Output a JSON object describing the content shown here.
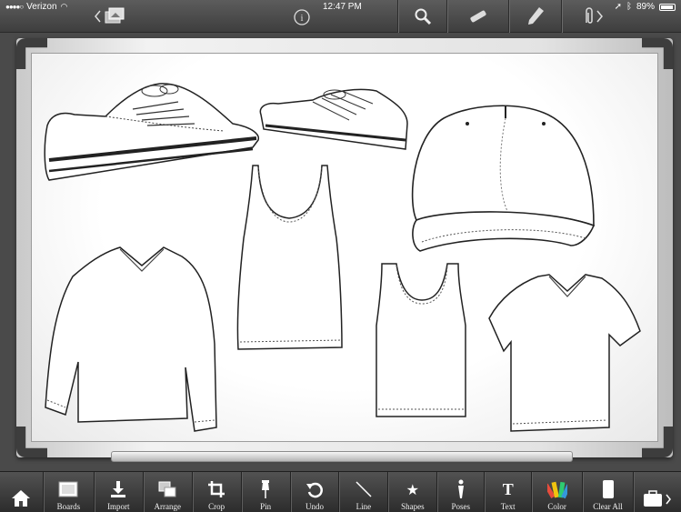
{
  "status_bar": {
    "carrier": "Verizon",
    "time": "12:47 PM",
    "battery": "89%"
  },
  "top_toolbar": {
    "left_icon": "photos-back-icon",
    "info_icon": "info-icon",
    "search_icon": "search-icon",
    "marker_icon": "marker-icon",
    "pencil_icon": "pencil-icon",
    "attach_icon": "paperclip-forward-icon"
  },
  "board": {
    "items": [
      "sneaker-left",
      "sneaker-right",
      "baseball-cap",
      "tank-top-women",
      "long-sleeve-vneck",
      "tank-top-men",
      "tshirt-vneck"
    ]
  },
  "bottom_toolbar": {
    "items": [
      {
        "label": "",
        "icon": "home-icon"
      },
      {
        "label": "Boards",
        "icon": "boards-icon"
      },
      {
        "label": "Import",
        "icon": "import-icon"
      },
      {
        "label": "Arrange",
        "icon": "arrange-icon"
      },
      {
        "label": "Crop",
        "icon": "crop-icon"
      },
      {
        "label": "Pin",
        "icon": "pin-icon"
      },
      {
        "label": "Undo",
        "icon": "undo-icon"
      },
      {
        "label": "Line",
        "icon": "line-icon"
      },
      {
        "label": "Shapes",
        "icon": "star-icon"
      },
      {
        "label": "Poses",
        "icon": "pose-icon"
      },
      {
        "label": "Text",
        "icon": "text-icon"
      },
      {
        "label": "Color",
        "icon": "color-fan-icon"
      },
      {
        "label": "Clear All",
        "icon": "eraser-icon"
      },
      {
        "label": "",
        "icon": "briefcase-icon"
      }
    ]
  }
}
